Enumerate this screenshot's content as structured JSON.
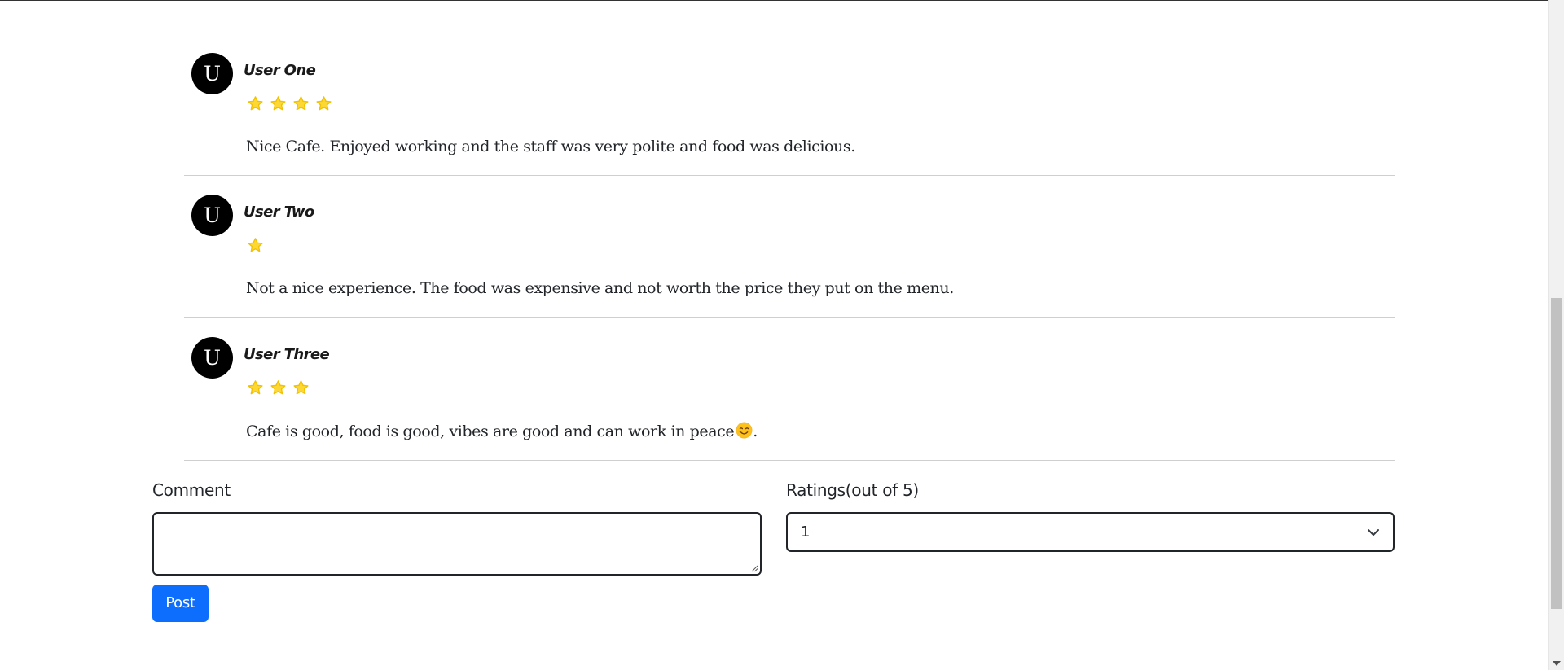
{
  "reviews": [
    {
      "avatar_letter": "U",
      "name": "User One",
      "rating": 4,
      "text": "Nice Cafe. Enjoyed working and the staff was very polite and food was delicious."
    },
    {
      "avatar_letter": "U",
      "name": "User Two",
      "rating": 1,
      "text": "Not a nice experience. The food was expensive and not worth the price they put on the menu."
    },
    {
      "avatar_letter": "U",
      "name": "User Three",
      "rating": 3,
      "text": "Cafe is good, food is good, vibes are good and can work in peace",
      "text_suffix": "."
    }
  ],
  "form": {
    "comment_label": "Comment",
    "comment_value": "",
    "ratings_label": "Ratings(out of 5)",
    "ratings_selected": "1",
    "post_label": "Post"
  },
  "colors": {
    "star": "#fdd835",
    "button": "#0d6efd",
    "avatar": "#000000"
  }
}
